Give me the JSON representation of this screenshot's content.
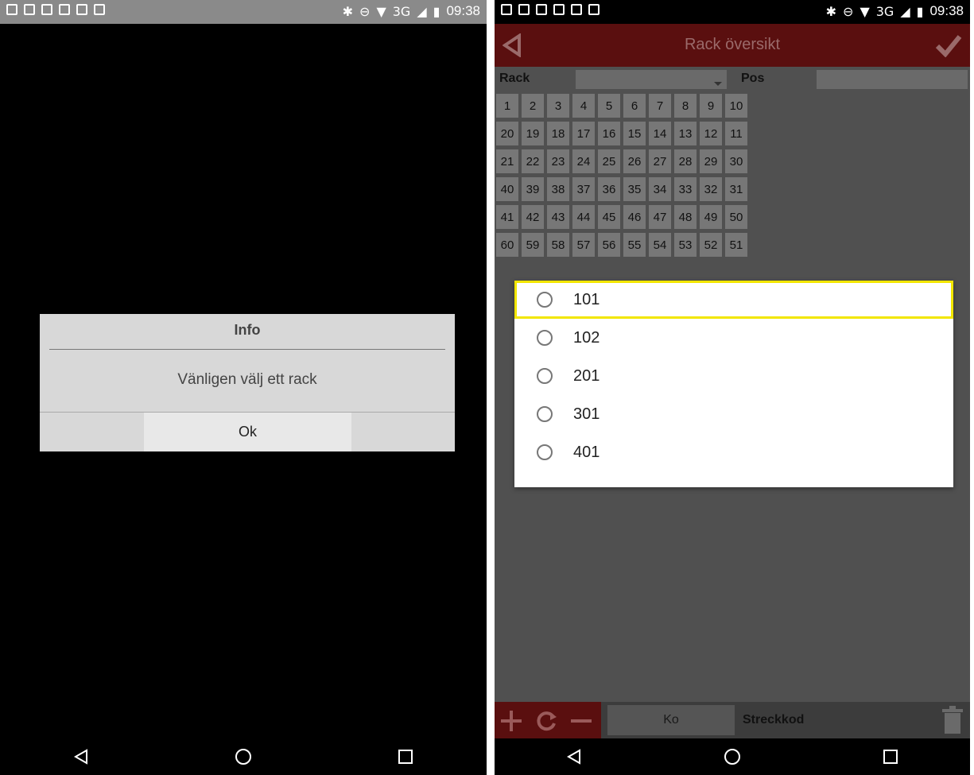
{
  "status_bar": {
    "time": "09:38",
    "network": "3G"
  },
  "left_screen": {
    "dialog": {
      "title": "Info",
      "message": "Vänligen välj ett rack",
      "ok_label": "Ok"
    }
  },
  "right_screen": {
    "app_bar": {
      "title": "Rack översikt"
    },
    "form": {
      "rack_label": "Rack",
      "pos_label": "Pos"
    },
    "grid_rows": [
      [
        "1",
        "2",
        "3",
        "4",
        "5",
        "6",
        "7",
        "8",
        "9",
        "10"
      ],
      [
        "20",
        "19",
        "18",
        "17",
        "16",
        "15",
        "14",
        "13",
        "12",
        "11"
      ],
      [
        "21",
        "22",
        "23",
        "24",
        "25",
        "26",
        "27",
        "28",
        "29",
        "30"
      ],
      [
        "40",
        "39",
        "38",
        "37",
        "36",
        "35",
        "34",
        "33",
        "32",
        "31"
      ],
      [
        "41",
        "42",
        "43",
        "44",
        "45",
        "46",
        "47",
        "48",
        "49",
        "50"
      ],
      [
        "60",
        "59",
        "58",
        "57",
        "56",
        "55",
        "54",
        "53",
        "52",
        "51"
      ]
    ],
    "rack_options": [
      "101",
      "102",
      "201",
      "301",
      "401"
    ],
    "bottom_bar": {
      "ko_label": "Ko",
      "barcode_label": "Streckkod"
    }
  },
  "colors": {
    "app_bar": "#5a0f0f",
    "highlight": "#f2e600",
    "overlay_bg": "#505050"
  }
}
